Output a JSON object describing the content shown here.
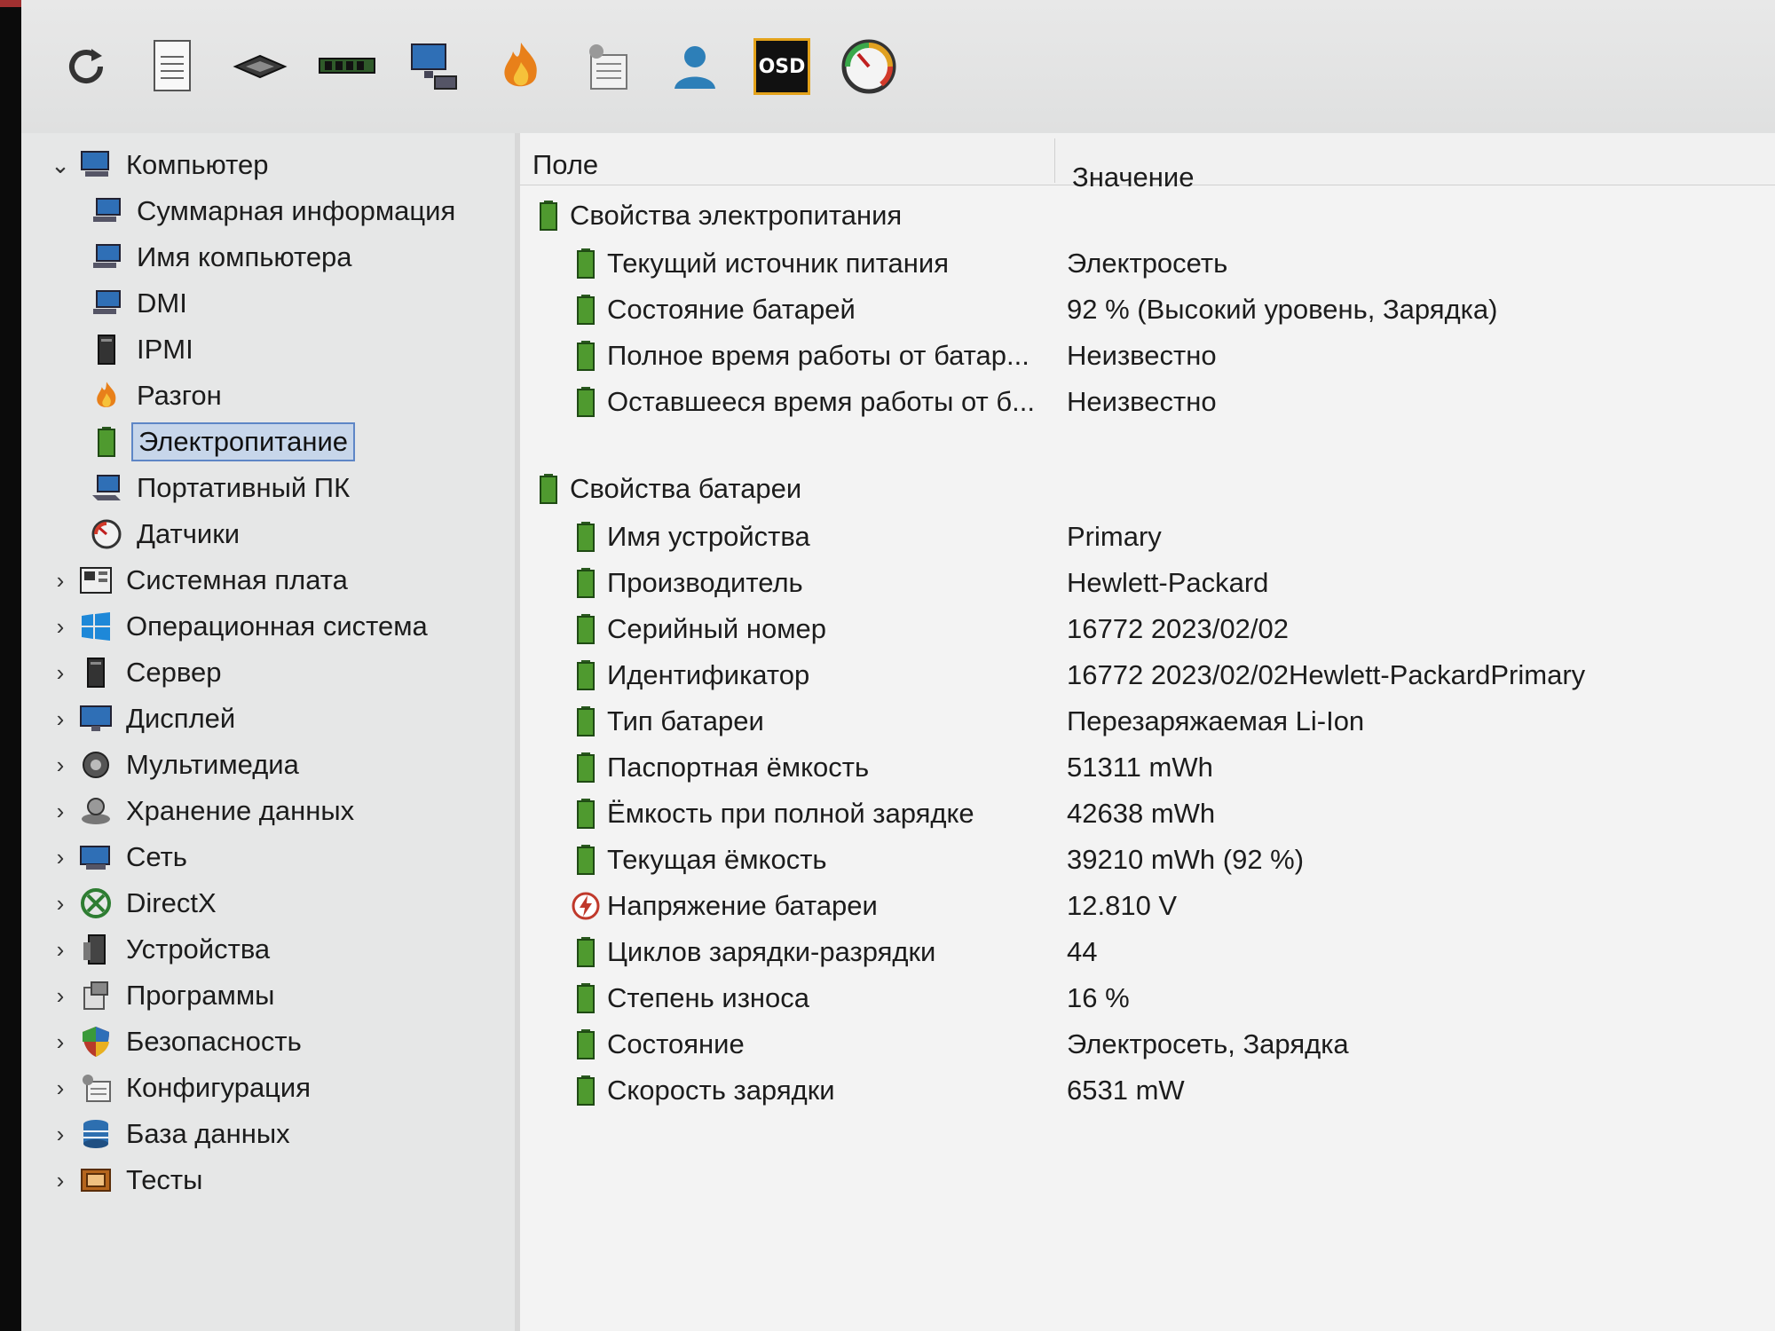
{
  "toolbar": {
    "buttons": [
      {
        "icon": "refresh-icon"
      },
      {
        "icon": "report-icon"
      },
      {
        "icon": "motherboard-chip-icon"
      },
      {
        "icon": "memory-module-icon"
      },
      {
        "icon": "network-computer-icon"
      },
      {
        "icon": "flame-icon"
      },
      {
        "icon": "config-list-icon"
      },
      {
        "icon": "user-icon"
      },
      {
        "icon": "osd-icon",
        "label": "OSD"
      },
      {
        "icon": "gauge-icon"
      }
    ]
  },
  "tree": {
    "root": {
      "label": "Компьютер",
      "expanded": true
    },
    "children": [
      {
        "label": "Суммарная информация",
        "icon": "computer-icon"
      },
      {
        "label": "Имя компьютера",
        "icon": "computer-icon"
      },
      {
        "label": "DMI",
        "icon": "computer-icon"
      },
      {
        "label": "IPMI",
        "icon": "server-icon"
      },
      {
        "label": "Разгон",
        "icon": "flame-icon"
      },
      {
        "label": "Электропитание",
        "icon": "battery-icon",
        "selected": true
      },
      {
        "label": "Портативный ПК",
        "icon": "laptop-icon"
      },
      {
        "label": "Датчики",
        "icon": "sensor-icon"
      }
    ],
    "sections": [
      {
        "label": "Системная плата",
        "icon": "motherboard-icon"
      },
      {
        "label": "Операционная система",
        "icon": "windows-icon"
      },
      {
        "label": "Сервер",
        "icon": "server-icon"
      },
      {
        "label": "Дисплей",
        "icon": "display-icon"
      },
      {
        "label": "Мультимедиа",
        "icon": "speaker-icon"
      },
      {
        "label": "Хранение данных",
        "icon": "storage-icon"
      },
      {
        "label": "Сеть",
        "icon": "network-icon"
      },
      {
        "label": "DirectX",
        "icon": "xbox-icon"
      },
      {
        "label": "Устройства",
        "icon": "devices-icon"
      },
      {
        "label": "Программы",
        "icon": "programs-icon"
      },
      {
        "label": "Безопасность",
        "icon": "shield-icon"
      },
      {
        "label": "Конфигурация",
        "icon": "config-icon"
      },
      {
        "label": "База данных",
        "icon": "database-icon"
      },
      {
        "label": "Тесты",
        "icon": "benchmark-icon"
      }
    ]
  },
  "details": {
    "columns": {
      "field": "Поле",
      "value": "Значение"
    },
    "groups": [
      {
        "title": "Свойства электропитания",
        "rows": [
          {
            "field": "Текущий источник питания",
            "value": "Электросеть",
            "icon": "battery-icon"
          },
          {
            "field": "Состояние батарей",
            "value": "92 % (Высокий уровень, Зарядка)",
            "icon": "battery-icon"
          },
          {
            "field": "Полное время работы от батар...",
            "value": "Неизвестно",
            "icon": "battery-icon"
          },
          {
            "field": "Оставшееся время работы от б...",
            "value": "Неизвестно",
            "icon": "battery-icon"
          }
        ]
      },
      {
        "title": "Свойства батареи",
        "rows": [
          {
            "field": "Имя устройства",
            "value": "Primary",
            "icon": "battery-icon"
          },
          {
            "field": "Производитель",
            "value": "Hewlett-Packard",
            "icon": "battery-icon"
          },
          {
            "field": "Серийный номер",
            "value": "16772 2023/02/02",
            "icon": "battery-icon"
          },
          {
            "field": "Идентификатор",
            "value": "16772 2023/02/02Hewlett-PackardPrimary",
            "icon": "battery-icon"
          },
          {
            "field": "Тип батареи",
            "value": "Перезаряжаемая Li-Ion",
            "icon": "battery-icon"
          },
          {
            "field": "Паспортная ёмкость",
            "value": "51311 mWh",
            "icon": "battery-icon"
          },
          {
            "field": "Ёмкость при полной зарядке",
            "value": "42638 mWh",
            "icon": "battery-icon"
          },
          {
            "field": "Текущая ёмкость",
            "value": "39210 mWh  (92 %)",
            "icon": "battery-icon"
          },
          {
            "field": "Напряжение батареи",
            "value": "12.810 V",
            "icon": "voltage-icon"
          },
          {
            "field": "Циклов зарядки-разрядки",
            "value": "44",
            "icon": "battery-icon"
          },
          {
            "field": "Степень износа",
            "value": "16 %",
            "icon": "battery-icon"
          },
          {
            "field": "Состояние",
            "value": "Электросеть, Зарядка",
            "icon": "battery-icon"
          },
          {
            "field": "Скорость зарядки",
            "value": "6531 mW",
            "icon": "battery-icon"
          }
        ]
      }
    ]
  }
}
